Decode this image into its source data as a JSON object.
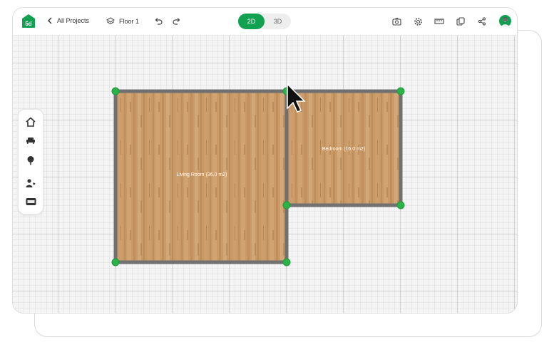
{
  "header": {
    "back_label": "All Projects",
    "floor_label": "Floor 1",
    "view_modes": [
      {
        "label": "2D",
        "active": true
      },
      {
        "label": "3D",
        "active": false
      }
    ],
    "toolbar_icons": [
      "undo-icon",
      "redo-icon",
      "camera-icon",
      "gear-icon",
      "ruler-icon",
      "copy-icon",
      "share-icon"
    ],
    "logo_text": "5d"
  },
  "sidebar": {
    "items": [
      {
        "icon": "home-icon"
      },
      {
        "icon": "sofa-icon"
      },
      {
        "icon": "tree-icon"
      },
      {
        "icon": "person-heart-icon"
      },
      {
        "icon": "new-badge-icon"
      }
    ]
  },
  "plan": {
    "rooms": [
      {
        "name": "Living Room",
        "label": "Living Room (36.0 m2)"
      },
      {
        "name": "Bedroom",
        "label": "Bedroom (16.0 m2)"
      }
    ]
  },
  "colors": {
    "accent": "#12a150",
    "wall": "#707070",
    "wood": "#c99a67",
    "node": "#2bb34a"
  }
}
